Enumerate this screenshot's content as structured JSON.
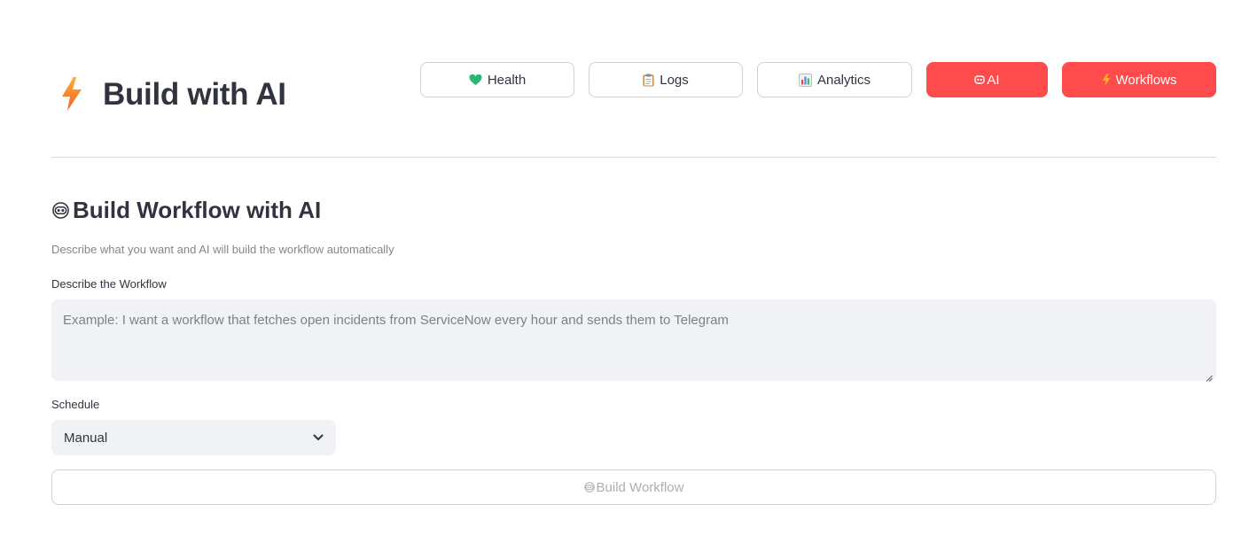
{
  "header": {
    "title": "Build with AI",
    "logo_icon": "lightning-bolt-icon"
  },
  "nav": {
    "buttons": [
      {
        "label": "Health",
        "icon": "green-heart-icon",
        "glyph": "💚",
        "variant": "secondary"
      },
      {
        "label": "Logs",
        "icon": "clipboard-icon",
        "glyph": "📋",
        "variant": "secondary"
      },
      {
        "label": "Analytics",
        "icon": "bar-chart-icon",
        "glyph": "📊",
        "variant": "secondary"
      },
      {
        "label": "AI",
        "icon": "robot-icon",
        "glyph": "",
        "variant": "primary"
      },
      {
        "label": "Workflows",
        "icon": "lightning-icon",
        "glyph": "⚡",
        "variant": "primary"
      }
    ]
  },
  "section": {
    "title": "Build Workflow with AI",
    "title_icon": "robot-icon",
    "caption": "Describe what you want and AI will build the workflow automatically"
  },
  "form": {
    "description_label": "Describe the Workflow",
    "description_value": "",
    "description_placeholder": "Example: I want a workflow that fetches open incidents from ServiceNow every hour and sends them to Telegram",
    "schedule_label": "Schedule",
    "schedule_value": "Manual",
    "build_label": "Build Workflow",
    "build_icon": "robot-icon"
  },
  "colors": {
    "primary": "#ff4b4b",
    "text": "#31333f",
    "input_bg": "#f0f2f6",
    "border": "#d6d6d9"
  }
}
